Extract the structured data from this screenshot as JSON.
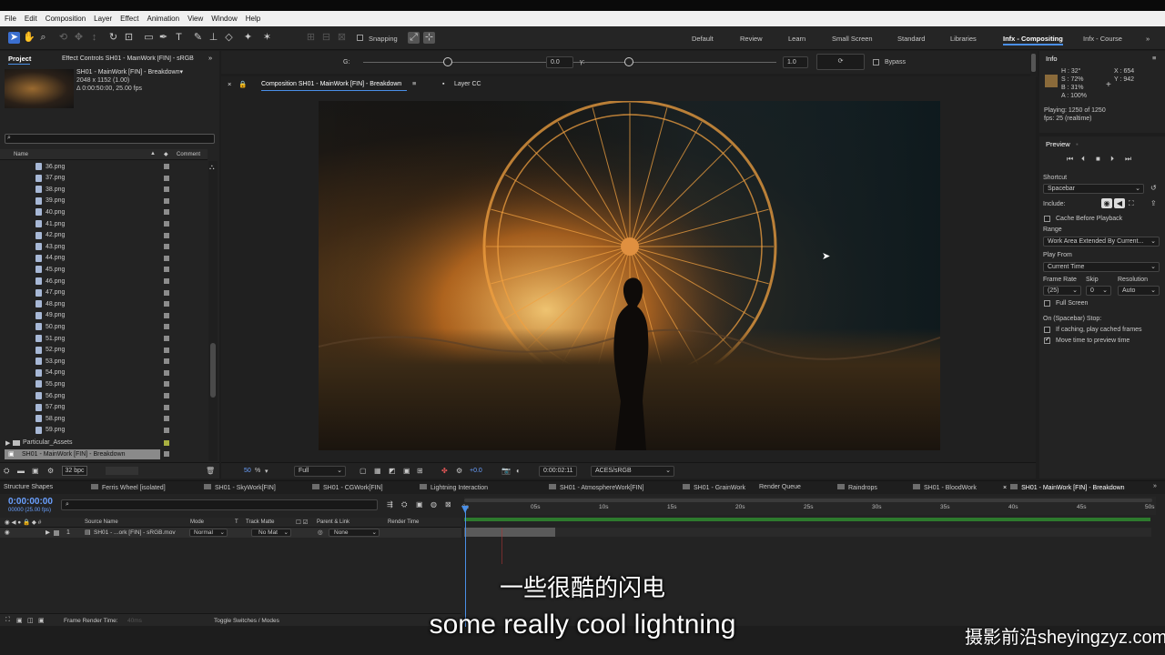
{
  "menu": [
    "File",
    "Edit",
    "Composition",
    "Layer",
    "Effect",
    "Animation",
    "View",
    "Window",
    "Help"
  ],
  "toolbar": {
    "snapping_label": "Snapping",
    "workspaces": [
      "Default",
      "Review",
      "Learn",
      "Small Screen",
      "Standard",
      "Libraries",
      "Infx - Compositing",
      "Infx - Course"
    ],
    "active_workspace": "Infx - Compositing"
  },
  "project": {
    "tab": "Project",
    "effect_controls_tab": "Effect Controls SH01 - MainWork [FIN] - sRGB",
    "item_name": "SH01 - MainWork [FIN] - Breakdown▾",
    "item_size": "2048 x 1152 (1.00)",
    "item_duration": "Δ 0:00:50:00, 25.00 fps",
    "search_placeholder": "",
    "col_name": "Name",
    "col_comment": "Comment",
    "files": [
      "36.png",
      "37.png",
      "38.png",
      "39.png",
      "40.png",
      "41.png",
      "42.png",
      "43.png",
      "44.png",
      "45.png",
      "46.png",
      "47.png",
      "48.png",
      "49.png",
      "50.png",
      "51.png",
      "52.png",
      "53.png",
      "54.png",
      "55.png",
      "56.png",
      "57.png",
      "58.png",
      "59.png"
    ],
    "folder": "Particular_Assets",
    "selected_comp": "SH01 - MainWork [FIN] - Breakdown",
    "bpc": "32 bpc"
  },
  "effect_bar": {
    "g_label": "G:",
    "g_value": "0.0",
    "y_label": "γ:",
    "y_value": "1.0",
    "bypass_label": "Bypass"
  },
  "viewer": {
    "comp_tab": "Composition SH01 - MainWork [FIN] - Breakdown",
    "layer_tab": "Layer CC",
    "zoom": "50",
    "zoom_unit": "%",
    "resolution": "Full",
    "exposure": "+0.0",
    "timecode": "0:00:02:11",
    "color_space": "ACES/sRGB"
  },
  "info": {
    "tab": "Info",
    "h": "H : 32°",
    "s": "S : 72%",
    "b": "B : 31%",
    "a": "A : 100%",
    "x": "X : 654",
    "y": "Y : 942",
    "playing": "Playing: 1250 of 1250",
    "fps": "fps: 25 (realtime)",
    "swatch_color": "#8a6a3a"
  },
  "preview": {
    "tab": "Preview",
    "shortcut_label": "Shortcut",
    "shortcut_value": "Spacebar",
    "include_label": "Include:",
    "cache_label": "Cache Before Playback",
    "range_label": "Range",
    "range_value": "Work Area Extended By Current...",
    "playfrom_label": "Play From",
    "playfrom_value": "Current Time",
    "framerate_label": "Frame Rate",
    "skip_label": "Skip",
    "resolution_label": "Resolution",
    "framerate_value": "(25)",
    "skip_value": "0",
    "resolution_value": "Auto",
    "fullscreen_label": "Full Screen",
    "stop_label": "On (Spacebar) Stop:",
    "cached_label": "If caching, play cached frames",
    "movetime_label": "Move time to preview time"
  },
  "timeline": {
    "tabs": [
      "Structure Shapes",
      "Ferris Wheel [isolated]",
      "SH01 - SkyWork[FIN]",
      "SH01 - CGWork[FIN]",
      "Lightning Interaction",
      "SH01 - AtmosphereWork[FIN]",
      "SH01 - GrainWork",
      "Render Queue",
      "Raindrops",
      "SH01 - BloodWork",
      "SH01 - MainWork [FIN] - Breakdown"
    ],
    "timecode": "0:00:00:00",
    "timecode_sub": "00000 (25.00 fps)",
    "cols": {
      "source": "Source Name",
      "mode": "Mode",
      "t": "T",
      "track": "Track Matte",
      "parent": "Parent & Link",
      "render": "Render Time"
    },
    "layer": {
      "num": "1",
      "name": "SH01 - ...ork [FIN] - sRGB.mov",
      "mode": "Normal",
      "track": "No Mat",
      "parent": "None"
    },
    "ruler": [
      "0s",
      "05s",
      "10s",
      "15s",
      "20s",
      "25s",
      "30s",
      "35s",
      "40s",
      "45s",
      "50s"
    ],
    "frame_render": "Frame Render Time:",
    "frame_render_val": "40ms",
    "toggle": "Toggle Switches / Modes"
  },
  "subtitles": {
    "cn": "一些很酷的闪电",
    "en": "some really cool lightning"
  },
  "watermark": "摄影前沿sheyingzyz.com"
}
